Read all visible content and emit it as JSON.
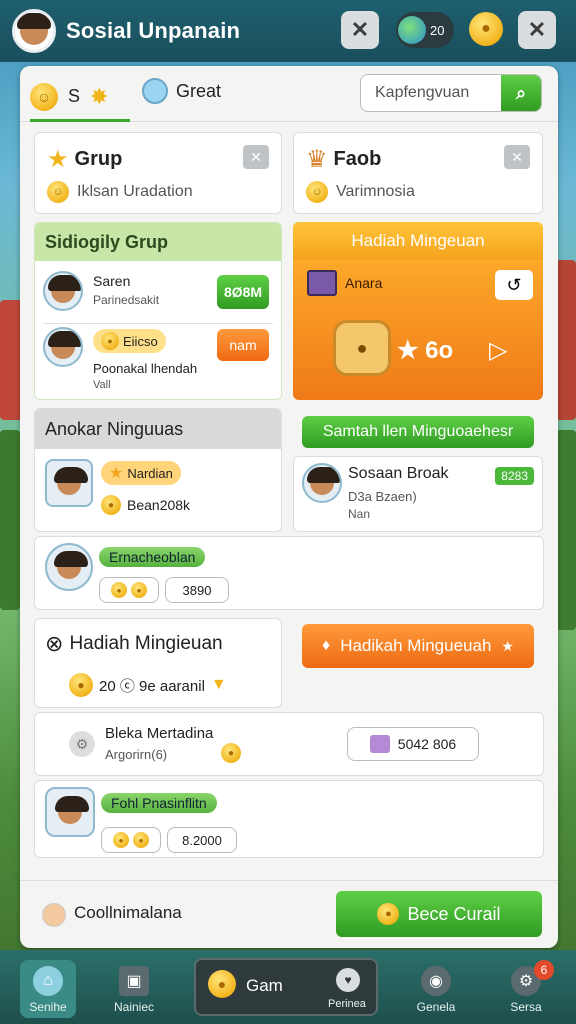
{
  "header": {
    "title": "Sosial Unpanain",
    "notif_count": "20"
  },
  "tabs": {
    "tab1_label": "S",
    "tab2_label": "Great",
    "search_placeholder": "Kapfengvuan"
  },
  "group_cards": [
    {
      "title": "Grup",
      "subtitle": "Iklsan Uradation"
    },
    {
      "title": "Faob",
      "subtitle": "Varimnosia"
    }
  ],
  "friend_group": {
    "heading": "Sidiogily Grup",
    "members": [
      {
        "name": "Saren",
        "detail": "Parinedsakit",
        "button": "8Ø8M"
      },
      {
        "name": "Eiicso",
        "detail": "Poonakal lhendah",
        "detail2": "Vall",
        "button": "nam"
      }
    ]
  },
  "weekly_reward": {
    "heading": "Hadiah Mingeuan",
    "item_label": "Anara",
    "value": "★ 6o"
  },
  "weekly_section": {
    "heading": "Anokar Ninguuas",
    "player": {
      "badge": "Nardian",
      "value": "Bean208k"
    }
  },
  "social_button": {
    "label": "Samtah llen Minguoaehesr"
  },
  "social_break": {
    "name": "Sosaan Broak",
    "line1": "D3a Bzaen)",
    "line2": "Nan",
    "badge": "8283"
  },
  "player2": {
    "tag": "Ernacheoblan",
    "value": "3890"
  },
  "reward2": {
    "heading": "Hadiah Mingieuan",
    "amount": "20 ⓒ 9e aaranil",
    "button": "Hadikah Mingueuah"
  },
  "blessing": {
    "title": "Bleka Mertadina",
    "subtitle": "Argorirn(6)",
    "value": "5042 806"
  },
  "player3": {
    "tag": "Fohl Pnasinflitn",
    "value": "8.2000"
  },
  "footer": {
    "label": "Coollnimalana",
    "button": "Bece Curail"
  },
  "nav": [
    {
      "label": "Senihe",
      "icon": "home-icon"
    },
    {
      "label": "Nainiec",
      "icon": "card-icon"
    },
    {
      "label": "Gam",
      "sub": "Perinea",
      "icon": "coin-icon"
    },
    {
      "label": "Genela",
      "icon": "location-icon"
    },
    {
      "label": "Sersa",
      "icon": "gear-icon"
    }
  ],
  "colors": {
    "accent_green": "#3aa82b",
    "accent_orange": "#f07a18",
    "header": "#1e5f6e"
  }
}
